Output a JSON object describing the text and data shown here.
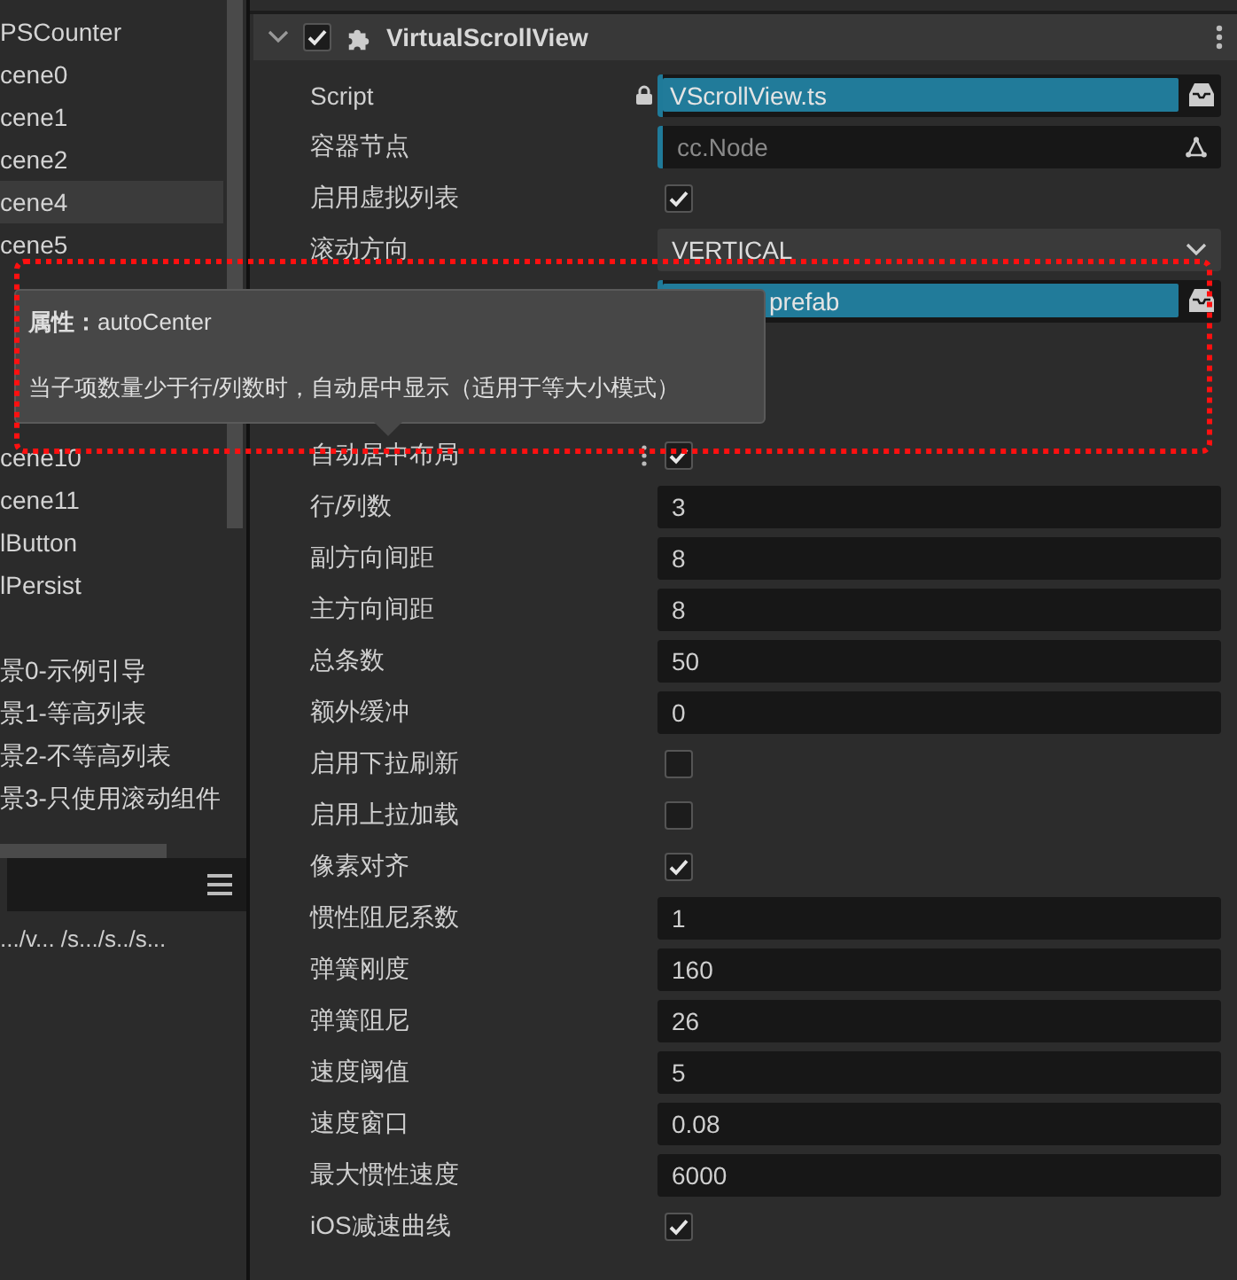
{
  "hierarchy": {
    "items": [
      {
        "label": "PSCounter",
        "selected": false
      },
      {
        "label": "cene0",
        "selected": false
      },
      {
        "label": "cene1",
        "selected": false
      },
      {
        "label": "cene2",
        "selected": false
      },
      {
        "label": "cene4",
        "selected": true
      },
      {
        "label": "cene5",
        "selected": false
      }
    ],
    "items_below_tooltip": [
      {
        "label": "cene10",
        "selected": false
      },
      {
        "label": "cene11",
        "selected": false
      },
      {
        "label": "lButton",
        "selected": false
      },
      {
        "label": "lPersist",
        "selected": false
      }
    ],
    "groups": [
      {
        "label": "景0-示例引导"
      },
      {
        "label": "景1-等高列表"
      },
      {
        "label": "景2-不等高列表"
      },
      {
        "label": "景3-只使用滚动组件"
      }
    ]
  },
  "path_bar": {
    "path": ".../v...  /s.../s../s..."
  },
  "component": {
    "title": "VirtualScrollView",
    "expanded": true,
    "enabled": true
  },
  "properties": [
    {
      "kind": "asset",
      "label": "Script",
      "locked": true,
      "value": "VScrollView.ts"
    },
    {
      "kind": "node",
      "label": "容器节点",
      "value": "cc.Node"
    },
    {
      "kind": "checkbox",
      "label": "启用虚拟列表",
      "checked": true
    },
    {
      "kind": "select",
      "label": "滚动方向",
      "value": "VERTICAL"
    },
    {
      "kind": "asset",
      "value": "prefab"
    },
    {
      "kind": "checkbox",
      "label": "自动居中布局",
      "checked": true,
      "hovered": true,
      "tooltip": {
        "title": "**属性：**autoCenter",
        "description": "当子项数量少于行/列数时，自动居中显示（适用于等大小模式）"
      }
    },
    {
      "kind": "number",
      "label": "行/列数",
      "value": "3"
    },
    {
      "kind": "number",
      "label": "副方向间距",
      "value": "8"
    },
    {
      "kind": "number",
      "label": "主方向间距",
      "value": "8"
    },
    {
      "kind": "number",
      "label": "总条数",
      "value": "50"
    },
    {
      "kind": "number",
      "label": "额外缓冲",
      "value": "0"
    },
    {
      "kind": "checkbox",
      "label": "启用下拉刷新",
      "checked": false
    },
    {
      "kind": "checkbox",
      "label": "启用上拉加载",
      "checked": false
    },
    {
      "kind": "checkbox",
      "label": "像素对齐",
      "checked": true
    },
    {
      "kind": "number",
      "label": "惯性阻尼系数",
      "value": "1"
    },
    {
      "kind": "number",
      "label": "弹簧刚度",
      "value": "160"
    },
    {
      "kind": "number",
      "label": "弹簧阻尼",
      "value": "26"
    },
    {
      "kind": "number",
      "label": "速度阈值",
      "value": "5"
    },
    {
      "kind": "number",
      "label": "速度窗口",
      "value": "0.08"
    },
    {
      "kind": "number",
      "label": "最大惯性速度",
      "value": "6000"
    },
    {
      "kind": "checkbox",
      "label": "iOS减速曲线",
      "checked": true
    }
  ]
}
